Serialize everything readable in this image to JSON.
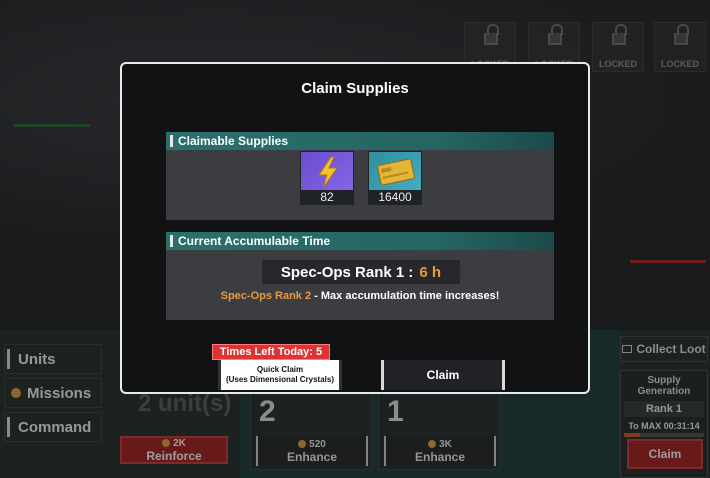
{
  "background": {
    "locked_slots": [
      "LOCKED",
      "LOCKED",
      "LOCKED",
      "LOCKED"
    ],
    "left_nav": [
      {
        "label": "Units",
        "icon": "bar-icon"
      },
      {
        "label": "Missions",
        "icon": "coin-icon"
      },
      {
        "label": "Command",
        "icon": "bar-icon"
      }
    ],
    "units_count": "2 unit(s)",
    "reinforce": {
      "cost": "2K",
      "label": "Reinforce"
    },
    "cards": [
      {
        "level": "2",
        "cost": "520",
        "label": "Enhance"
      },
      {
        "level": "1",
        "cost": "3K",
        "label": "Enhance"
      }
    ],
    "collect_loot": "Collect Loot",
    "supply_generation": {
      "title": "Supply Generation",
      "rank": "Rank 1",
      "to_max": "To MAX 00:31:14",
      "claim": "Claim"
    }
  },
  "modal": {
    "title": "Claim Supplies",
    "claimable_header": "Claimable Supplies",
    "items": [
      {
        "icon": "lightning-icon",
        "quantity": "82"
      },
      {
        "icon": "credit-card-icon",
        "quantity": "16400"
      }
    ],
    "accum_header": "Current Accumulable Time",
    "spec_ops_label": "Spec-Ops Rank 1 :",
    "spec_ops_value": "6 h",
    "next_rank": "Spec-Ops Rank 2",
    "next_rank_note": "- Max accumulation time increases!",
    "times_left": "Times Left Today: 5",
    "quick_claim": "Quick Claim",
    "quick_claim_sub": "(Uses Dimensional Crystals)",
    "claim": "Claim"
  },
  "colors": {
    "accent": "#e89a40",
    "section_teal": "#2b6f6c",
    "red": "#a02828",
    "times_red": "#d33333"
  }
}
